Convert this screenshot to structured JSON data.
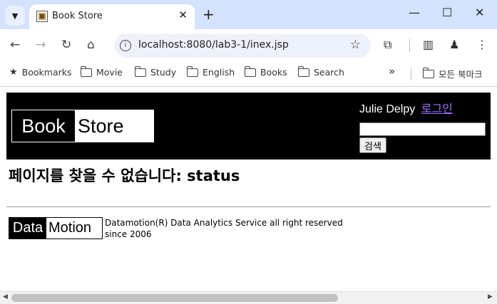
{
  "browser": {
    "tab_title": "Book Store",
    "url": "localhost:8080/lab3-1/inex.jsp",
    "bookmarks": [
      "Bookmarks",
      "Movie",
      "Study",
      "English",
      "Books",
      "Search"
    ],
    "overflow": "»",
    "all_bookmarks": "모든 북마크"
  },
  "page": {
    "logo_left": "Book",
    "logo_right": "Store",
    "user_name": "Julie Delpy",
    "login_label": "로그인",
    "search_value": "",
    "search_button": "검색",
    "error_message": "페이지를 찾을 수 없습니다: status",
    "footer_logo_left": "Data",
    "footer_logo_right": "Motion",
    "footer_line1": "Datamotion(R) Data Analytics Service all right reserved",
    "footer_line2": "since 2006"
  }
}
